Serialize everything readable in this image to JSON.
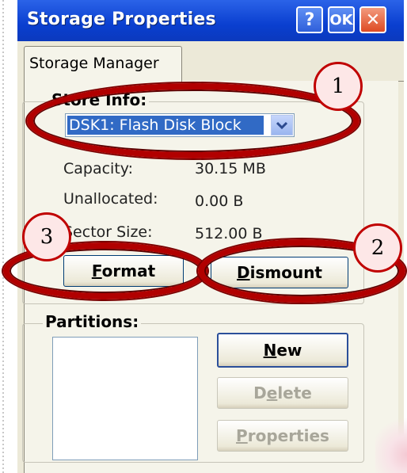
{
  "window": {
    "title": "Storage Properties",
    "help_label": "?",
    "ok_label": "OK",
    "close_label": "✕"
  },
  "tabs": [
    {
      "label": "Storage Manager",
      "selected": true
    }
  ],
  "store_info": {
    "group_label": "Store Info:",
    "selected_store": "DSK1: Flash Disk Block",
    "rows": [
      {
        "label": "Capacity:",
        "value": "30.15 MB"
      },
      {
        "label": "Unallocated:",
        "value": "0.00 B"
      },
      {
        "label": "Sector Size:",
        "value": "512.00 B"
      }
    ],
    "format_pre": "",
    "format_mnemonic": "F",
    "format_post": "ormat",
    "dismount_pre": "",
    "dismount_mnemonic": "D",
    "dismount_post": "ismount"
  },
  "partitions": {
    "group_label": "Partitions:",
    "items": [],
    "new_pre": "",
    "new_mnemonic": "N",
    "new_post": "ew",
    "delete_pre": "D",
    "delete_mnemonic": "e",
    "delete_post": "lete",
    "properties_pre": "",
    "properties_mnemonic": "P",
    "properties_post": "roperties",
    "delete_enabled": false,
    "properties_enabled": false
  },
  "annotations": {
    "marker_1": "1",
    "marker_2": "2",
    "marker_3": "3",
    "color": "#b10000"
  },
  "colors": {
    "titlebar": "#0a3fd0",
    "selection": "#316ac5",
    "dialog_bg": "#f5f4ea"
  }
}
